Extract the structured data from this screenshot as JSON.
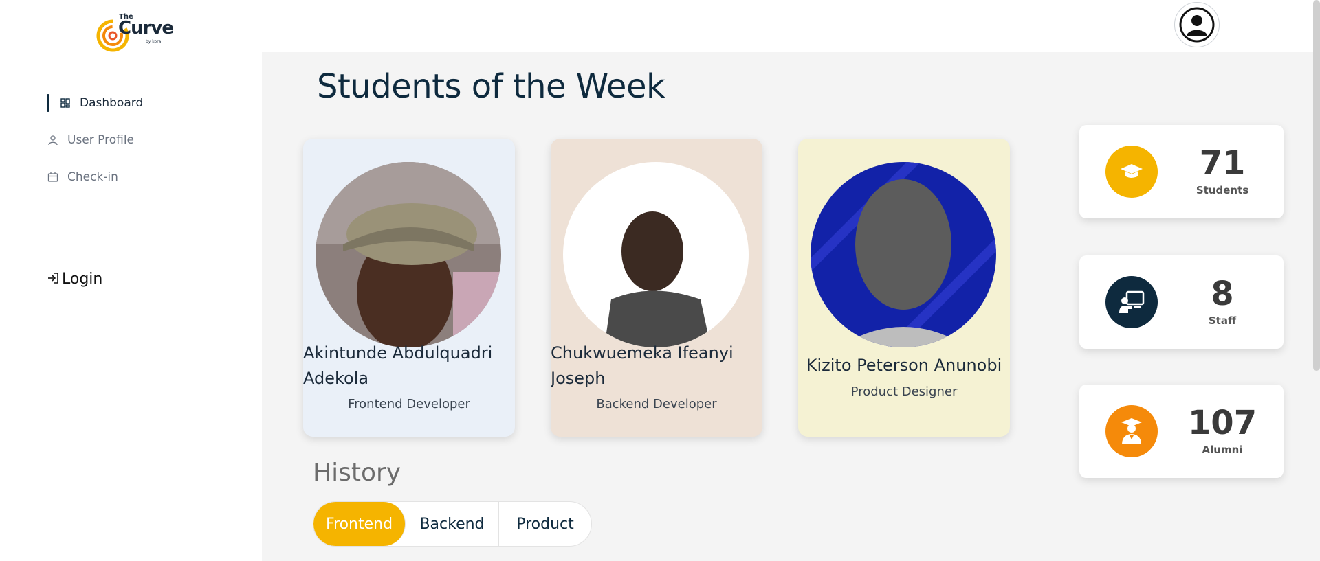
{
  "logo": {
    "top": "The",
    "main": "Curve",
    "sub": "by kora"
  },
  "sidebar": {
    "items": [
      {
        "label": "Dashboard",
        "icon": "dashboard-icon",
        "active": true
      },
      {
        "label": "User Profile",
        "icon": "user-icon",
        "active": false
      },
      {
        "label": "Check-in",
        "icon": "calendar-icon",
        "active": false
      }
    ],
    "login_label": "Login"
  },
  "header": {
    "avatar_icon": "user-avatar-icon"
  },
  "main": {
    "title": "Students of the Week",
    "students": [
      {
        "name": "Akintunde Abdulquadri Adekola",
        "role": "Frontend Developer",
        "bg": "#eaf0f8"
      },
      {
        "name": "Chukwuemeka Ifeanyi Joseph",
        "role": "Backend Developer",
        "bg": "#eee1d6"
      },
      {
        "name": "Kizito Peterson Anunobi",
        "role": "Product Designer",
        "bg": "#f5f2d3"
      }
    ],
    "stats": [
      {
        "value": "71",
        "label": "Students",
        "color": "#f5b400",
        "icon": "graduation-cap-icon"
      },
      {
        "value": "8",
        "label": "Staff",
        "color": "#0e2a3e",
        "icon": "teacher-icon"
      },
      {
        "value": "107",
        "label": "Alumni",
        "color": "#f58a0a",
        "icon": "graduate-icon"
      }
    ],
    "history_title": "History",
    "tabs": [
      {
        "label": "Frontend",
        "active": true
      },
      {
        "label": "Backend",
        "active": false
      },
      {
        "label": "Product",
        "active": false
      }
    ]
  },
  "colors": {
    "accent": "#f5b400",
    "navy": "#0e2a3e",
    "orange": "#f58a0a",
    "main_bg": "#f4f4f4"
  }
}
